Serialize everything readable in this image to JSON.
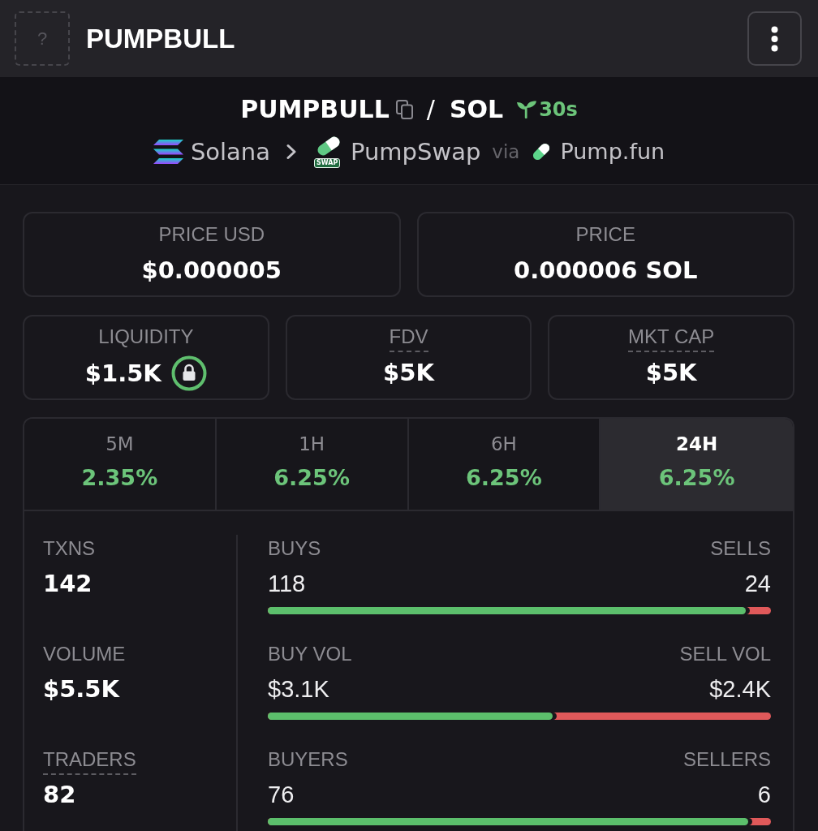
{
  "header": {
    "token_icon": "?",
    "title": "PUMPBULL"
  },
  "pair": {
    "base": "PUMPBULL",
    "separator": "/",
    "quote": "SOL",
    "age": "30s"
  },
  "route": {
    "chain": "Solana",
    "dex": "PumpSwap",
    "dex_badge": "SWAP",
    "via": "via",
    "launchpad": "Pump.fun"
  },
  "price_cards": [
    {
      "label": "PRICE USD",
      "value": "$0.000005"
    },
    {
      "label": "PRICE",
      "value": "0.000006 SOL"
    }
  ],
  "metric_cards": [
    {
      "label": "LIQUIDITY",
      "value": "$1.5K",
      "underlined": false,
      "locked": true
    },
    {
      "label": "FDV",
      "value": "$5K",
      "underlined": true,
      "locked": false
    },
    {
      "label": "MKT CAP",
      "value": "$5K",
      "underlined": true,
      "locked": false
    }
  ],
  "periods": [
    {
      "label": "5M",
      "change": "2.35%",
      "selected": false
    },
    {
      "label": "1H",
      "change": "6.25%",
      "selected": false
    },
    {
      "label": "6H",
      "change": "6.25%",
      "selected": false
    },
    {
      "label": "24H",
      "change": "6.25%",
      "selected": true
    }
  ],
  "stats": [
    {
      "label": "TXNS",
      "value": "142",
      "underlined": false
    },
    {
      "label": "VOLUME",
      "value": "$5.5K",
      "underlined": false
    },
    {
      "label": "TRADERS",
      "value": "82",
      "underlined": true
    }
  ],
  "splits": [
    {
      "left_label": "BUYS",
      "left_value": "118",
      "right_label": "SELLS",
      "right_value": "24",
      "level": 0.95
    },
    {
      "left_label": "BUY VOL",
      "left_value": "$3.1K",
      "right_label": "SELL VOL",
      "right_value": "$2.4K",
      "level": 0.566
    },
    {
      "left_label": "BUYERS",
      "left_value": "76",
      "right_label": "SELLERS",
      "right_value": "6",
      "level": 0.955
    }
  ]
}
